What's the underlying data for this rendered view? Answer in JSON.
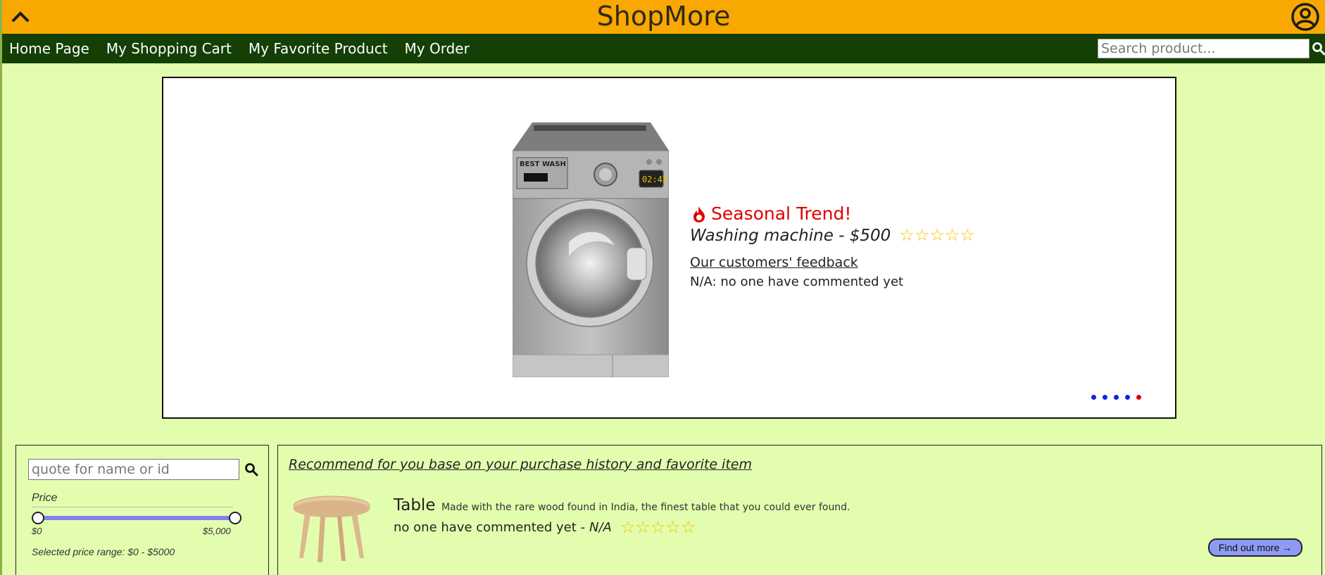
{
  "header": {
    "title": "ShopMore",
    "collapse_icon": "chevron-up-icon",
    "account_icon": "user-circle-icon",
    "brand_color": "#f8a800"
  },
  "nav": {
    "items": [
      {
        "label": "Home Page"
      },
      {
        "label": "My Shopping Cart"
      },
      {
        "label": "My Favorite Product"
      },
      {
        "label": "My Order"
      }
    ],
    "search_placeholder": "Search product...",
    "search_icon": "search-icon",
    "background_color": "#143f05"
  },
  "carousel": {
    "badge": "Seasonal Trend!",
    "product": "Washing machine - $500",
    "rating_stars": 0,
    "feedback_link": "Our customers' feedback",
    "feedback_text": "N/A: no one have commented yet",
    "slides_count": 5,
    "active_slide": 5
  },
  "filter": {
    "query_placeholder": "quote for name or id",
    "price_label": "Price",
    "min_label": "$0",
    "max_label": "$5,000",
    "range_text": "Selected price range: $0 - $5000",
    "range_min_value": 0,
    "range_max_value": 5000
  },
  "recommend": {
    "title": "Recommend for you base on your purchase history and favorite item",
    "item": {
      "name": "Table",
      "description": "Made with the rare wood found in India, the finest table that you could ever found.",
      "feedback": "no one have commented yet -",
      "rating_text": "N/A",
      "rating_stars": 0
    },
    "more_button": "Find out more →"
  }
}
